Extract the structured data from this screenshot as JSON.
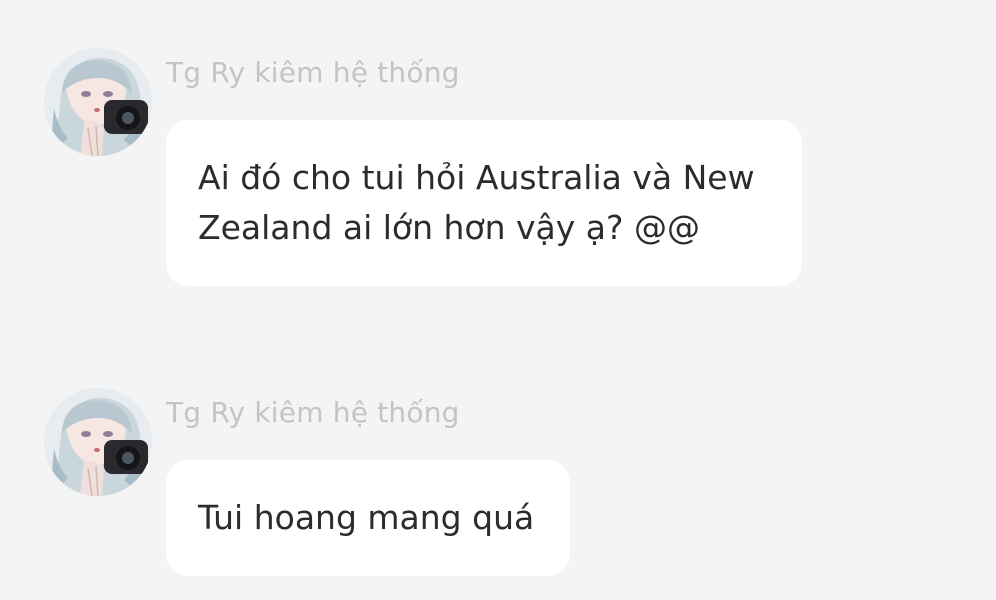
{
  "messages": [
    {
      "sender": "Tg Ry kiêm hệ thống",
      "lines": [
        "Ai đó cho tui hỏi Australia và New",
        "Zealand ai lớn hơn vậy ạ? @@"
      ]
    },
    {
      "sender": "Tg Ry kiêm hệ thống",
      "lines": [
        "Tui hoang mang quá"
      ]
    }
  ],
  "colors": {
    "background": "#f4f4f4",
    "bubble": "#ffffff",
    "sender_text": "#c4c4c4",
    "message_text": "#2c2c2c"
  },
  "icons": {
    "avatar": "anime-girl-with-camera-avatar"
  }
}
